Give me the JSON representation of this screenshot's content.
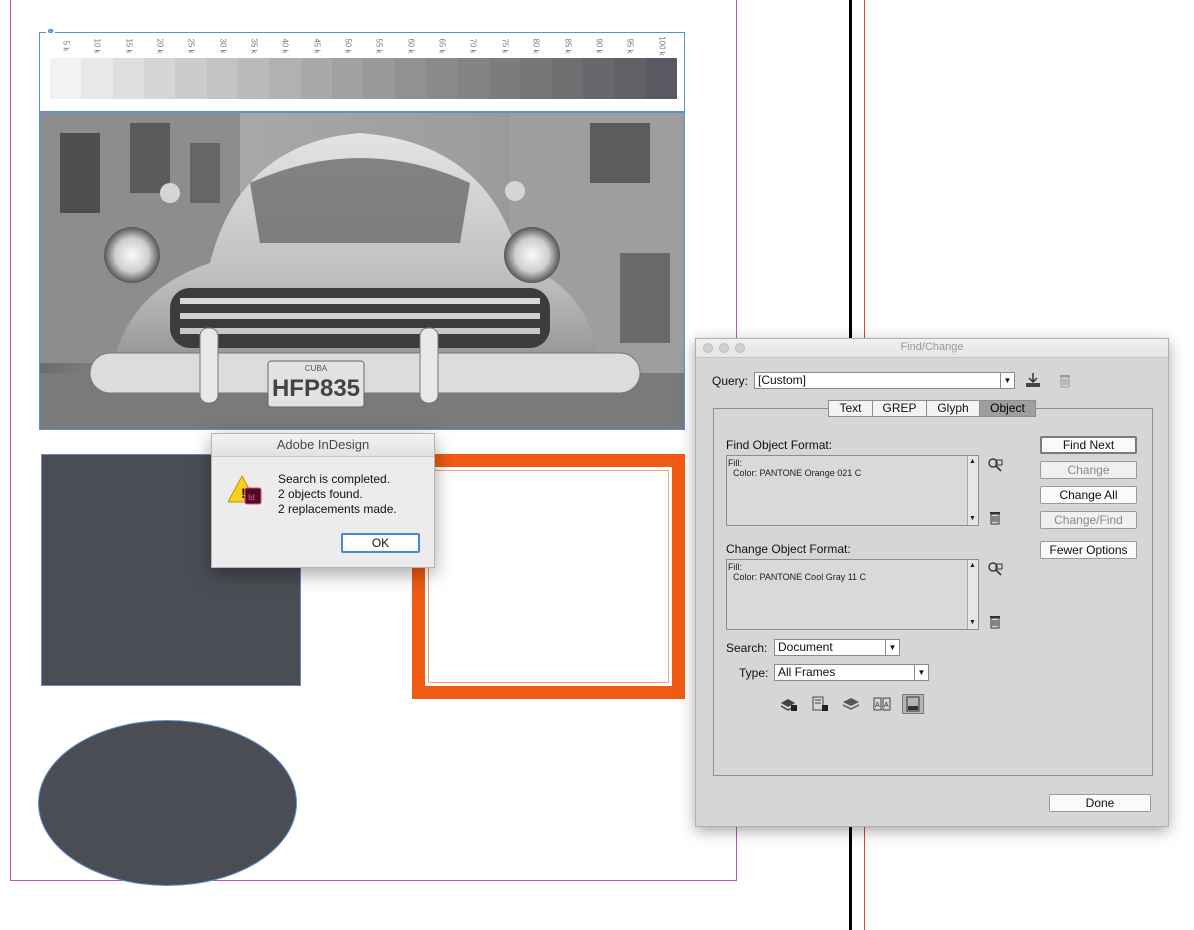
{
  "document": {
    "swatch_labels": [
      "5 k",
      "10 k",
      "15 k",
      "20 k",
      "25 k",
      "30 k",
      "35 k",
      "40 k",
      "45 k",
      "50 k",
      "55 k",
      "60 k",
      "65 k",
      "70 k",
      "75 k",
      "80 k",
      "85 k",
      "90 k",
      "95 k",
      "100 k"
    ],
    "swatch_colors": [
      "#f2f2f2",
      "#e8e8e8",
      "#dedede",
      "#d5d5d5",
      "#cccccc",
      "#c3c3c3",
      "#bababa",
      "#b1b1b1",
      "#a9a9a9",
      "#a1a1a1",
      "#999999",
      "#919191",
      "#8a8a8a",
      "#838383",
      "#7c7c7c",
      "#757676",
      "#6e6f71",
      "#67686c",
      "#606167",
      "#595a61"
    ],
    "photo": {
      "plate_text": "HFP835",
      "plate_top": "CUBA"
    },
    "colors": {
      "dark_fill": "#4a4d54",
      "orange_stroke": "#f05a14"
    }
  },
  "alert": {
    "title": "Adobe InDesign",
    "lines": [
      "Search is completed.",
      "2 objects found.",
      "2 replacements made."
    ],
    "ok_label": "OK",
    "icon": "warning-indesign-icon"
  },
  "find_change": {
    "title": "Find/Change",
    "query_label": "Query:",
    "query_value": "[Custom]",
    "tabs": [
      "Text",
      "GREP",
      "Glyph",
      "Object"
    ],
    "active_tab": "Object",
    "find_format_label": "Find Object Format:",
    "find_format_lines": [
      "Fill:",
      "Color: PANTONE Orange 021 C"
    ],
    "change_format_label": "Change Object Format:",
    "change_format_lines": [
      "Fill:",
      "Color: PANTONE Cool Gray 11 C"
    ],
    "search_label": "Search:",
    "search_value": "Document",
    "type_label": "Type:",
    "type_value": "All Frames",
    "buttons": {
      "find_next": "Find Next",
      "change": "Change",
      "change_all": "Change All",
      "change_find": "Change/Find",
      "fewer_options": "Fewer Options",
      "done": "Done"
    }
  }
}
